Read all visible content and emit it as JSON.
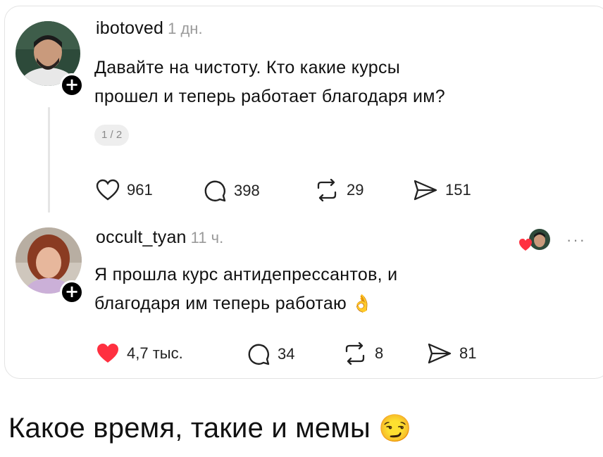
{
  "post": {
    "username": "ibotoved",
    "time": "1 дн.",
    "text_line1": "Давайте на чистоту. Кто какие курсы",
    "text_line2": "прошел и теперь работает благодаря им?",
    "pager": "1 / 2",
    "likes": "961",
    "comments": "398",
    "reposts": "29",
    "shares": "151"
  },
  "reply": {
    "username": "occult_tyan",
    "time": "11 ч.",
    "text_line1": "Я прошла курс антидепрессантов, и",
    "text_line2": "благодаря им теперь работаю",
    "emoji": "👌",
    "likes": "4,7 тыс.",
    "comments": "34",
    "reposts": "8",
    "shares": "81",
    "more": "···"
  },
  "caption": {
    "text": "Какое время, такие и мемы",
    "emoji": "😏"
  },
  "colors": {
    "like_red": "#ff3040",
    "text": "#111111",
    "muted": "#9a9a9a",
    "border": "#e3e3e3"
  }
}
